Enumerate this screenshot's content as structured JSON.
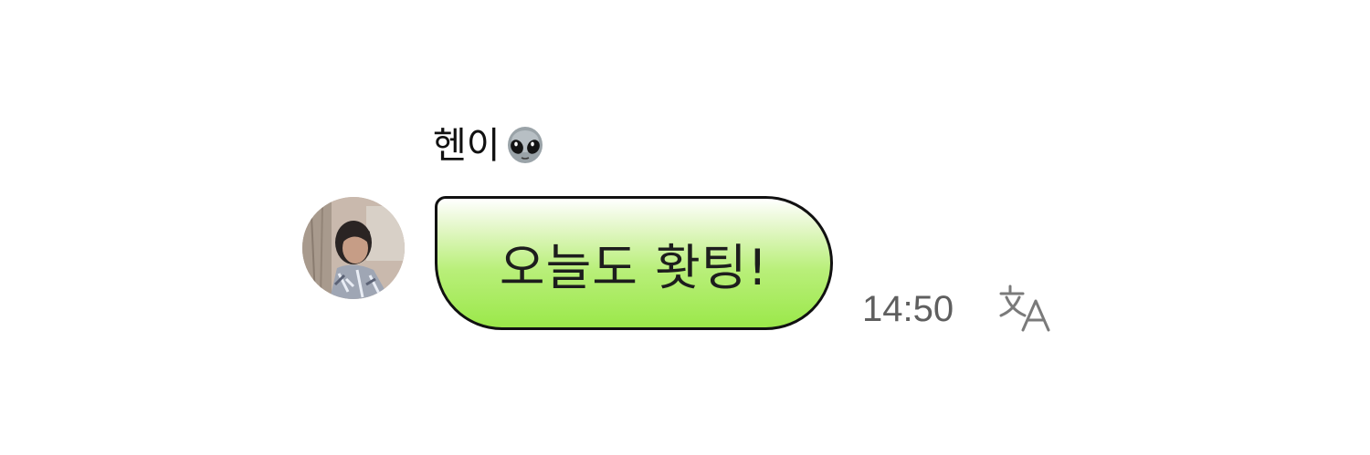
{
  "message": {
    "sender_name": "헨이",
    "sender_emoji_icon": "alien-face-icon",
    "avatar_icon": "profile-photo",
    "text": "오늘도 홧팅!",
    "time": "14:50",
    "translate_icon": "translate-icon"
  },
  "colors": {
    "bubble_top": "#ffffff",
    "bubble_bottom": "#9be84a",
    "bubble_border": "#111111",
    "timestamp": "#5f5f5f"
  }
}
